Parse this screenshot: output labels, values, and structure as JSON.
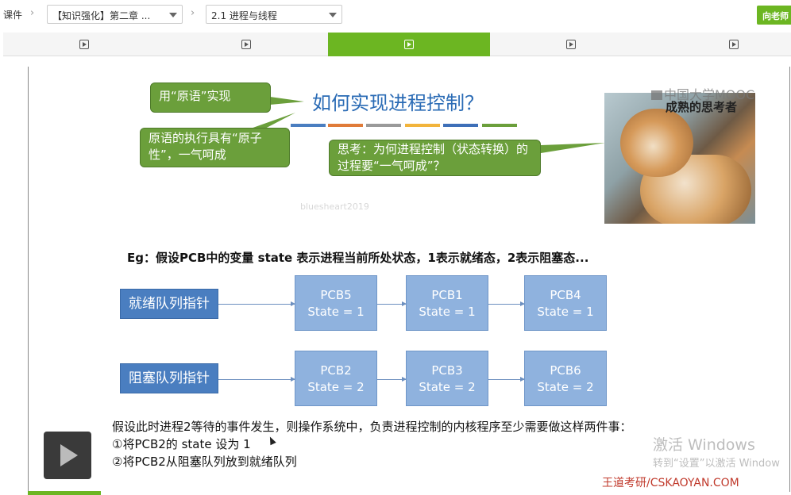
{
  "breadcrumb": {
    "root": "课件",
    "chapter_select": "【知识强化】第二章 ...",
    "section_select": "2.1 进程与线程"
  },
  "ask_button": "向老师",
  "video_tabs": [
    {
      "icon": "play-icon",
      "active": false
    },
    {
      "icon": "play-icon",
      "active": false
    },
    {
      "icon": "play-icon",
      "active": true
    },
    {
      "icon": "play-icon",
      "active": false
    },
    {
      "icon": "play-icon",
      "active": false
    }
  ],
  "slide": {
    "title": "如何实现进程控制？",
    "color_bar": [
      "#4a7ec0",
      "#e07b39",
      "#9a9a9a",
      "#f2b43c",
      "#3e6fb8",
      "#6b9f3b"
    ],
    "callout_primitive": "用“原语”实现",
    "callout_atomic": "原语的执行具有“原子性”，一气呵成",
    "callout_think": "思考：为何进程控制（状态转换）的过程要“一气呵成”？",
    "photo_caption": "成熟的思考者",
    "mooc_logo": "中国大学MOOC",
    "watermark": "bluesheart2019",
    "eg_text": "Eg：假设PCB中的变量 state 表示进程当前所处状态，1表示就绪态，2表示阻塞态...",
    "ready_queue": {
      "label": "就绪队列指针",
      "pcbs": [
        {
          "name": "PCB5",
          "state": "State = 1"
        },
        {
          "name": "PCB1",
          "state": "State = 1"
        },
        {
          "name": "PCB4",
          "state": "State = 1"
        }
      ]
    },
    "blocked_queue": {
      "label": "阻塞队列指针",
      "pcbs": [
        {
          "name": "PCB2",
          "state": "State = 2"
        },
        {
          "name": "PCB3",
          "state": "State = 2"
        },
        {
          "name": "PCB6",
          "state": "State = 2"
        }
      ]
    },
    "para_intro": "假设此时进程2等待的事件发生，则操作系统中，负责进程控制的内核程序至少需要做这样两件事：",
    "step1": "①将PCB2的 state 设为 1",
    "step2": "②将PCB2从阻塞队列放到就绪队列",
    "brand": "王道考研/CSKAOYAN.COM"
  },
  "windows_activation": {
    "line1": "激活 Windows",
    "line2": "转到“设置”以激活 Window"
  },
  "colors": {
    "accent_green": "#6cb622",
    "title_blue": "#2a6bb5",
    "callout_green": "#6b9f3b",
    "queue_blue": "#4a7ec0",
    "pcb_blue": "#8fb2de"
  }
}
